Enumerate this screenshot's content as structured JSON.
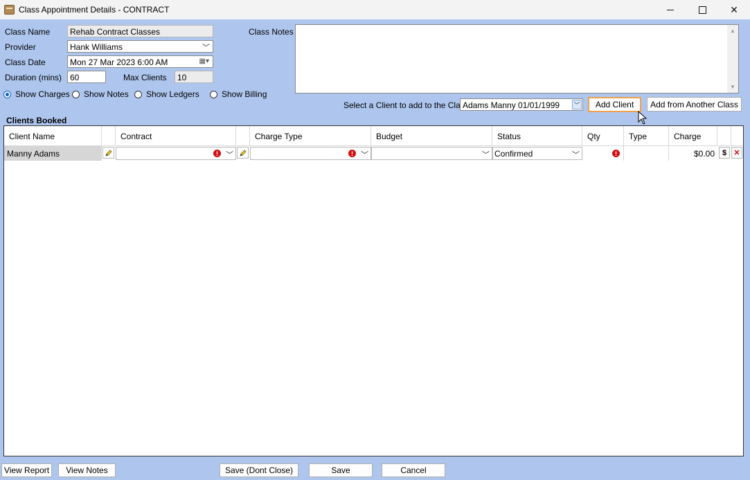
{
  "window": {
    "title": "Class Appointment Details - CONTRACT"
  },
  "form": {
    "class_name_label": "Class Name",
    "class_name_value": "Rehab Contract Classes",
    "provider_label": "Provider",
    "provider_value": "Hank Williams",
    "class_date_label": "Class Date",
    "class_date_value": "Mon 27 Mar 2023   6:00 AM",
    "duration_label": "Duration (mins)",
    "duration_value": "60",
    "max_clients_label": "Max Clients",
    "max_clients_value": "10",
    "class_notes_label": "Class Notes",
    "class_notes_value": ""
  },
  "view_options": [
    {
      "label": "Show Charges",
      "checked": true
    },
    {
      "label": "Show Notes",
      "checked": false
    },
    {
      "label": "Show Ledgers",
      "checked": false
    },
    {
      "label": "Show Billing",
      "checked": false
    }
  ],
  "client_select": {
    "label": "Select a Client to add to the Class",
    "value": "Adams Manny 01/01/1999",
    "add_client": "Add Client",
    "add_from_another": "Add from Another Class"
  },
  "grid": {
    "title": "Clients Booked",
    "columns": [
      "Client Name",
      "Contract",
      "Charge Type",
      "Budget",
      "Status",
      "Qty",
      "Type",
      "Charge"
    ],
    "rows": [
      {
        "client_name": "Manny Adams",
        "contract": "",
        "charge_type": "",
        "budget": "",
        "status": "Confirmed",
        "qty": "",
        "type": "",
        "charge": "$0.00"
      }
    ]
  },
  "footer": {
    "view_report": "View Report",
    "view_notes": "View Notes",
    "save_dont_close": "Save (Dont Close)",
    "save": "Save",
    "cancel": "Cancel"
  },
  "colors": {
    "background": "#aec6ee",
    "focus_border": "#f0a04a",
    "error": "#d40d12",
    "radio_accent": "#0a5fc0"
  }
}
